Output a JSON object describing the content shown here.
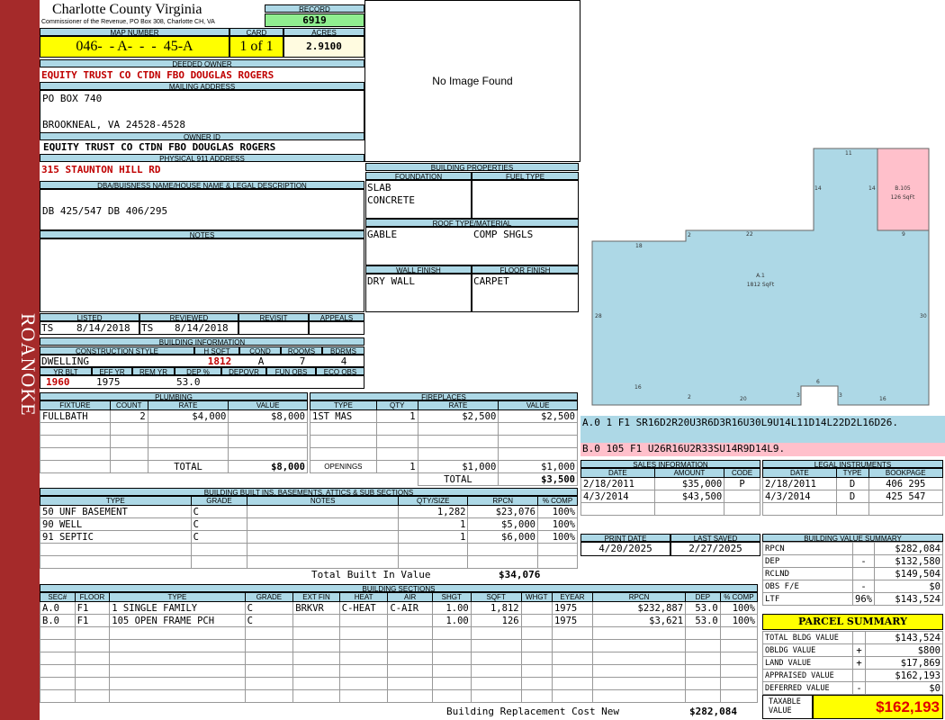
{
  "side_label": "ROANOKE",
  "county": {
    "title": "Charlotte County Virginia",
    "subtitle": "Commissioner of the Revenue, PO Box 308, Charlotte CH, VA"
  },
  "record": {
    "label": "RECORD",
    "value": "6919"
  },
  "map": {
    "label": "MAP NUMBER",
    "value": "046-  - A-  -  -  45-A",
    "card_label": "CARD",
    "card": "1 of 1",
    "acres_label": "ACRES",
    "acres": "2.9100"
  },
  "deeded_owner": {
    "label": "DEEDED OWNER",
    "value": "EQUITY TRUST CO CTDN FBO DOUGLAS ROGERS"
  },
  "mailing": {
    "label": "MAILING ADDRESS",
    "line1": "PO BOX 740",
    "line2": "BROOKNEAL, VA 24528-4528"
  },
  "owner_id": {
    "label": "OWNER ID",
    "value": "EQUITY TRUST CO CTDN FBO DOUGLAS ROGERS"
  },
  "physical": {
    "label": "PHYSICAL 911 ADDRESS",
    "value": "315 STAUNTON HILL RD"
  },
  "legal": {
    "label": "DBA/BUISNESS NAME/HOUSE NAME & LEGAL DESCRIPTION",
    "value": "DB 425/547 DB 406/295"
  },
  "notes": {
    "label": "NOTES"
  },
  "photo": {
    "text": "No Image Found"
  },
  "listed": {
    "listed_label": "LISTED",
    "listed_by": "TS",
    "listed_date": "8/14/2018",
    "reviewed_label": "REVIEWED",
    "reviewed_by": "TS",
    "reviewed_date": "8/14/2018",
    "revisit_label": "REVISIT",
    "appeals_label": "APPEALS"
  },
  "building_info": {
    "label": "BUILDING INFORMATION",
    "style_label": "CONSTRUCTION STYLE",
    "hsqft_label": "H SQFT",
    "cond_label": "COND",
    "rooms_label": "ROOMS",
    "bdrms_label": "BDRMS",
    "style": "DWELLING",
    "hsqft": "1812",
    "cond": "A",
    "rooms": "7",
    "bdrms": "4",
    "yrblt_label": "YR BLT",
    "effyr_label": "EFF YR",
    "remyr_label": "REM YR",
    "dep_label": "DEP %",
    "depovr_label": "DEPOVR",
    "funobs_label": "FUN OBS",
    "ecoobs_label": "ECO OBS",
    "yrblt": "1960",
    "effyr": "1975",
    "remyr": "",
    "dep": "53.0"
  },
  "building_props": {
    "label": "BUILDING PROPERTIES",
    "foundation_label": "FOUNDATION",
    "fuel_label": "FUEL TYPE",
    "foundation1": "SLAB",
    "foundation2": "CONCRETE",
    "roof_label": "ROOF TYPE/MATERIAL",
    "roof_type": "GABLE",
    "roof_material": "COMP SHGLS",
    "wall_label": "WALL FINISH",
    "floor_label": "FLOOR FINISH",
    "wall": "DRY WALL",
    "floor": "CARPET"
  },
  "sketch": {
    "a_label": "A.1",
    "a_sqft": "1812 SqFt",
    "b_label": "B.105",
    "b_sqft": "126 SqFt",
    "dims": [
      "11",
      "14",
      "14",
      "18",
      "2",
      "22",
      "9",
      "28",
      "30",
      "16",
      "2",
      "20",
      "3",
      "6",
      "3",
      "16"
    ]
  },
  "sketch_codes": {
    "a": "A.0   1    F1   SR16D2R20U3R6D3R16U30L9U14L11D14L22D2L16D26.",
    "b": "B.0   105  F1   U26R16U2R33SU14R9D14L9."
  },
  "plumbing": {
    "label": "PLUMBING",
    "headers": [
      "FIXTURE",
      "COUNT",
      "RATE",
      "VALUE"
    ],
    "rows": [
      [
        "FULLBATH",
        "2",
        "$4,000",
        "$8,000"
      ]
    ],
    "total_label": "TOTAL",
    "total": "$8,000"
  },
  "fireplaces": {
    "label": "FIREPLACES",
    "headers": [
      "TYPE",
      "QTY",
      "RATE",
      "VALUE"
    ],
    "rows": [
      [
        "1ST MAS",
        "1",
        "$2,500",
        "$2,500"
      ]
    ],
    "openings_label": "OPENINGS",
    "openings_qty": "1",
    "openings_rate": "$1,000",
    "openings_value": "$1,000",
    "total_label": "TOTAL",
    "total": "$3,500"
  },
  "sales": {
    "label": "SALES INFORMATION",
    "headers": [
      "DATE",
      "AMOUNT",
      "CODE"
    ],
    "rows": [
      [
        "2/18/2011",
        "$35,000",
        "P"
      ],
      [
        "4/3/2014",
        "$43,500",
        ""
      ]
    ]
  },
  "legal_instr": {
    "label": "LEGAL INSTRUMENTS",
    "headers": [
      "DATE",
      "TYPE",
      "BOOKPAGE"
    ],
    "rows": [
      [
        "2/18/2011",
        "D",
        "406 295"
      ],
      [
        "4/3/2014",
        "D",
        "425 547"
      ]
    ]
  },
  "print": {
    "print_label": "PRINT DATE",
    "print_date": "4/20/2025",
    "saved_label": "LAST SAVED",
    "saved_date": "2/27/2025"
  },
  "builtins": {
    "label": "BUILDING BUILT INS, BASEMENTS, ATTICS & SUB SECTIONS",
    "headers": [
      "TYPE",
      "GRADE",
      "NOTES",
      "QTY/SIZE",
      "RPCN",
      "% COMP"
    ],
    "rows": [
      [
        "50 UNF BASEMENT",
        "C",
        "",
        "1,282",
        "$23,076",
        "100%"
      ],
      [
        "90 WELL",
        "C",
        "",
        "1",
        "$5,000",
        "100%"
      ],
      [
        "91 SEPTIC",
        "C",
        "",
        "1",
        "$6,000",
        "100%"
      ]
    ],
    "total_label": "Total Built In Value",
    "total": "$34,076"
  },
  "value_summary": {
    "label": "BUILDING VALUE SUMMARY",
    "rows": [
      [
        "RPCN",
        "",
        "$282,084"
      ],
      [
        "DEP",
        "-",
        "$132,580"
      ],
      [
        "RCLND",
        "",
        "$149,504"
      ],
      [
        "OBS F/E",
        "-",
        "$0"
      ],
      [
        "LTF",
        "96%",
        "$143,524"
      ]
    ]
  },
  "parcel_summary": {
    "label": "PARCEL SUMMARY",
    "rows": [
      [
        "TOTAL BLDG VALUE",
        "",
        "$143,524"
      ],
      [
        "OBLDG VALUE",
        "+",
        "$800"
      ],
      [
        "LAND VALUE",
        "+",
        "$17,869"
      ],
      [
        "APPRAISED VALUE",
        "",
        "$162,193"
      ],
      [
        "DEFERRED VALUE",
        "-",
        "$0"
      ]
    ],
    "taxable_label1": "TAXABLE",
    "taxable_label2": "VALUE",
    "taxable": "$162,193"
  },
  "sections": {
    "label": "BUILDING SECTIONS",
    "headers": [
      "SEC#",
      "FLOOR",
      "TYPE",
      "GRADE",
      "EXT FIN",
      "HEAT",
      "AIR",
      "SHGT",
      "SQFT",
      "WHGT",
      "EYEAR",
      "RPCN",
      "DEP",
      "% COMP"
    ],
    "rows": [
      [
        "A.0",
        "F1",
        "1 SINGLE FAMILY",
        "C",
        "BRKVR",
        "C-HEAT",
        "C-AIR",
        "1.00",
        "1,812",
        "",
        "1975",
        "$232,887",
        "53.0",
        "100%"
      ],
      [
        "B.0",
        "F1",
        "105 OPEN FRAME PCH",
        "C",
        "",
        "",
        "",
        "1.00",
        "126",
        "",
        "1975",
        "$3,621",
        "53.0",
        "100%"
      ]
    ],
    "total_label": "Building Replacement Cost New",
    "total": "$282,084"
  }
}
